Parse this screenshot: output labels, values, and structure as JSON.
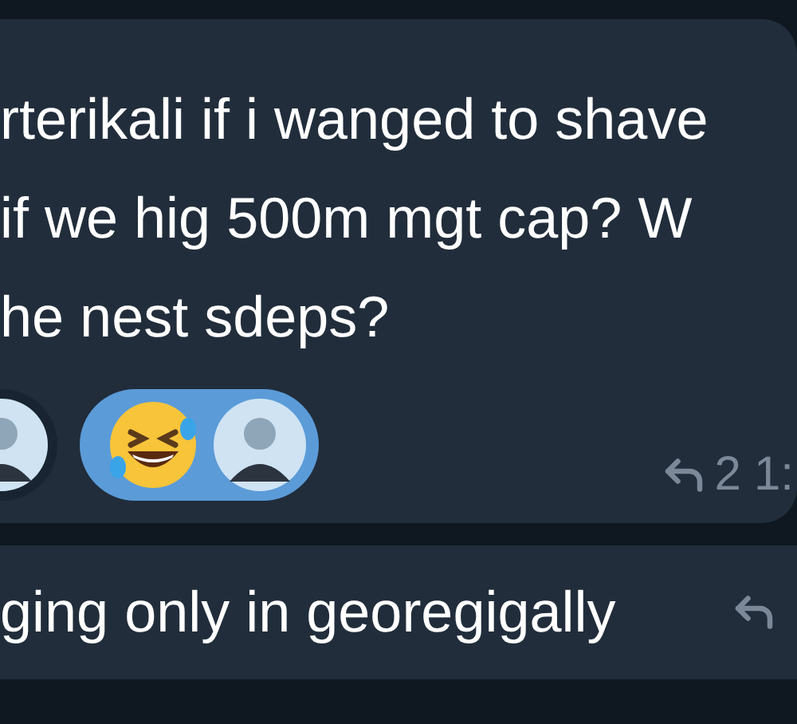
{
  "messages": [
    {
      "lines": [
        "rterikali if i wanged to shave",
        "if we hig 500m mgt cap? W",
        "he nest sdeps?"
      ],
      "reactions": [
        {
          "kind": "avatar",
          "selected": false
        },
        {
          "kind": "emoji_avatar",
          "selected": true
        }
      ],
      "reply_count": "2",
      "time": "1:"
    },
    {
      "text": "ging only in georegigally"
    }
  ]
}
